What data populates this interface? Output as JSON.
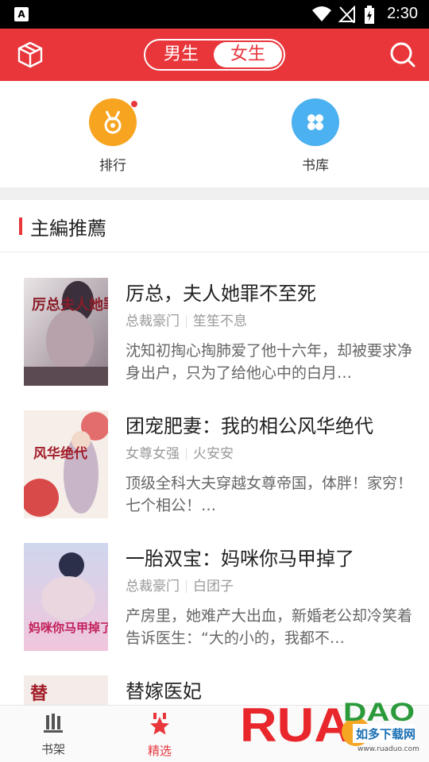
{
  "status_bar": {
    "time": "2:30",
    "app_badge": "A"
  },
  "header": {
    "gender_tabs": [
      {
        "label": "男生",
        "selected": false
      },
      {
        "label": "女生",
        "selected": true
      }
    ],
    "accent_color": "#e8363b"
  },
  "quick_links": [
    {
      "label": "排行",
      "icon": "medal-icon",
      "has_badge": true
    },
    {
      "label": "书库",
      "icon": "grid-icon",
      "has_badge": false
    }
  ],
  "section": {
    "title": "主編推薦"
  },
  "books": [
    {
      "title": "厉总，夫人她罪不至死",
      "category": "总裁豪门",
      "author": "笙笙不息",
      "description": "沈知初掏心掏肺爱了他十六年，却被要求净身出户，只为了给他心中的白月…",
      "cover_text": "厉总夫人她罪不至死"
    },
    {
      "title": "团宠肥妻：我的相公风华绝代",
      "category": "女尊女强",
      "author": "火安安",
      "description": "顶级全科大夫穿越女尊帝国，体胖！家穷！七个相公！…",
      "cover_text": "风华绝代"
    },
    {
      "title": "一胎双宝：妈咪你马甲掉了",
      "category": "总裁豪门",
      "author": "白团子",
      "description": "产房里，她难产大出血，新婚老公却冷笑着告诉医生：“大的小的，我都不…",
      "cover_text": "妈咪你马甲掉了"
    },
    {
      "title": "替嫁医妃",
      "category": "",
      "author": "",
      "description": "",
      "cover_text": "替"
    }
  ],
  "tab_bar": [
    {
      "label": "书架",
      "icon": "bookshelf-icon",
      "active": false
    },
    {
      "label": "精选",
      "icon": "featured-star-icon",
      "active": true
    }
  ],
  "watermark": {
    "brand": "RUANDAO",
    "subtitle": "如多下载网",
    "url": "www.ruaduo.com"
  }
}
